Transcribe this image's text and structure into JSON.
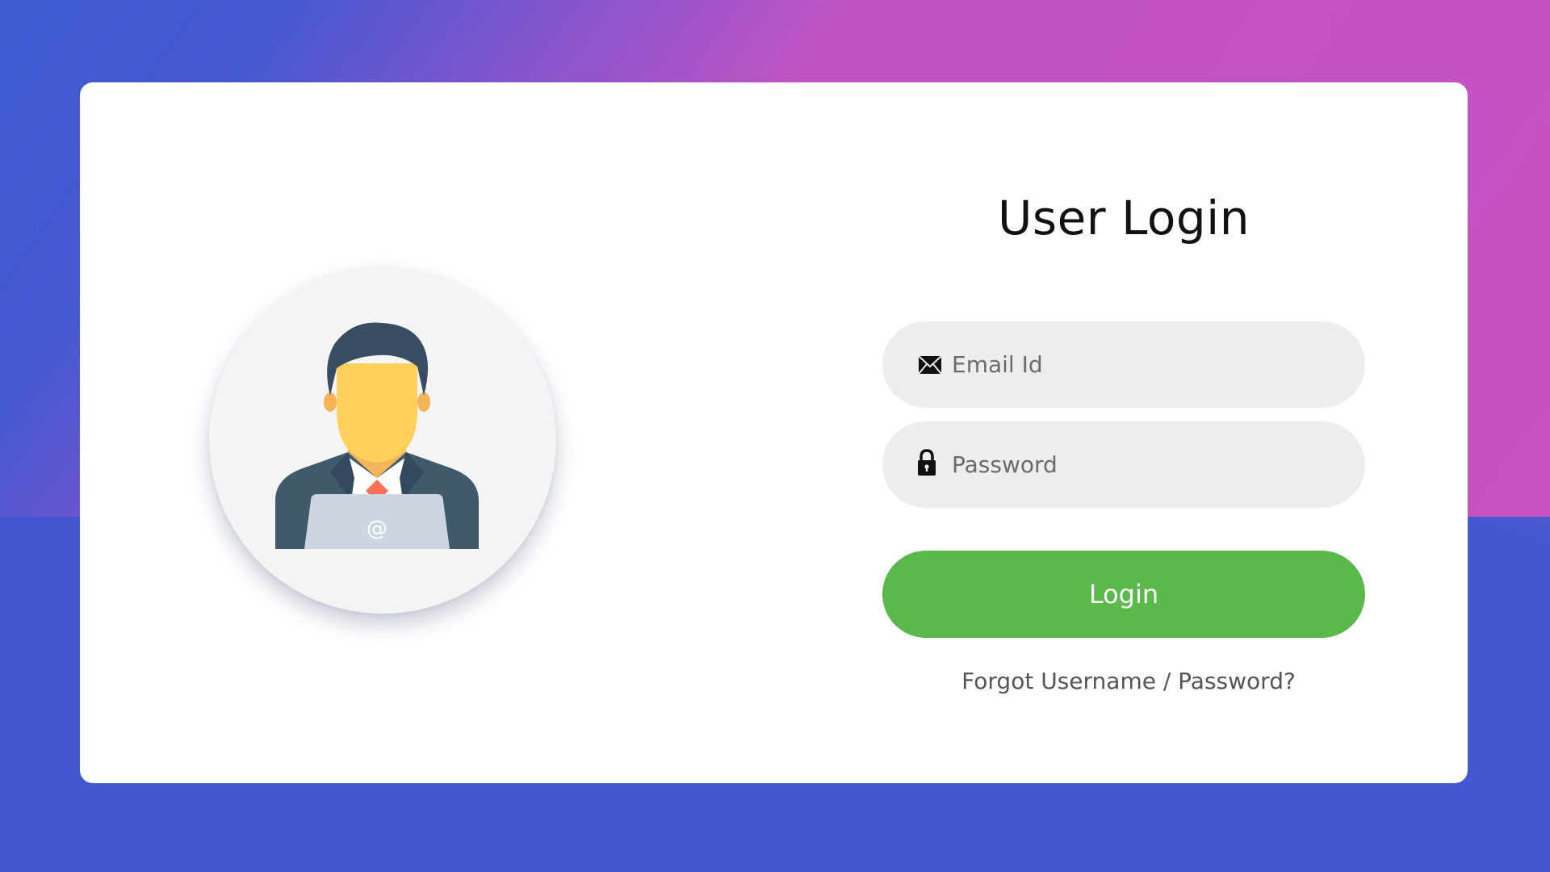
{
  "login": {
    "title": "User Login",
    "email_placeholder": "Email Id",
    "password_placeholder": "Password",
    "login_label": "Login",
    "forgot_label": "Forgot Username / Password?"
  },
  "avatar": {
    "laptop_symbol": "@"
  },
  "icons": {
    "email": "envelope-icon",
    "password": "lock-icon"
  },
  "colors": {
    "background_gradient_start": "#3f5ad3",
    "background_gradient_end": "#c752c2",
    "card": "#ffffff",
    "input_background": "#ededed",
    "login_button": "#5ab94a",
    "avatar_hair": "#384c64",
    "avatar_face": "#ffd05b",
    "avatar_suit": "#415a6b",
    "avatar_tie": "#ff7058",
    "avatar_laptop": "#cdd6e0"
  }
}
